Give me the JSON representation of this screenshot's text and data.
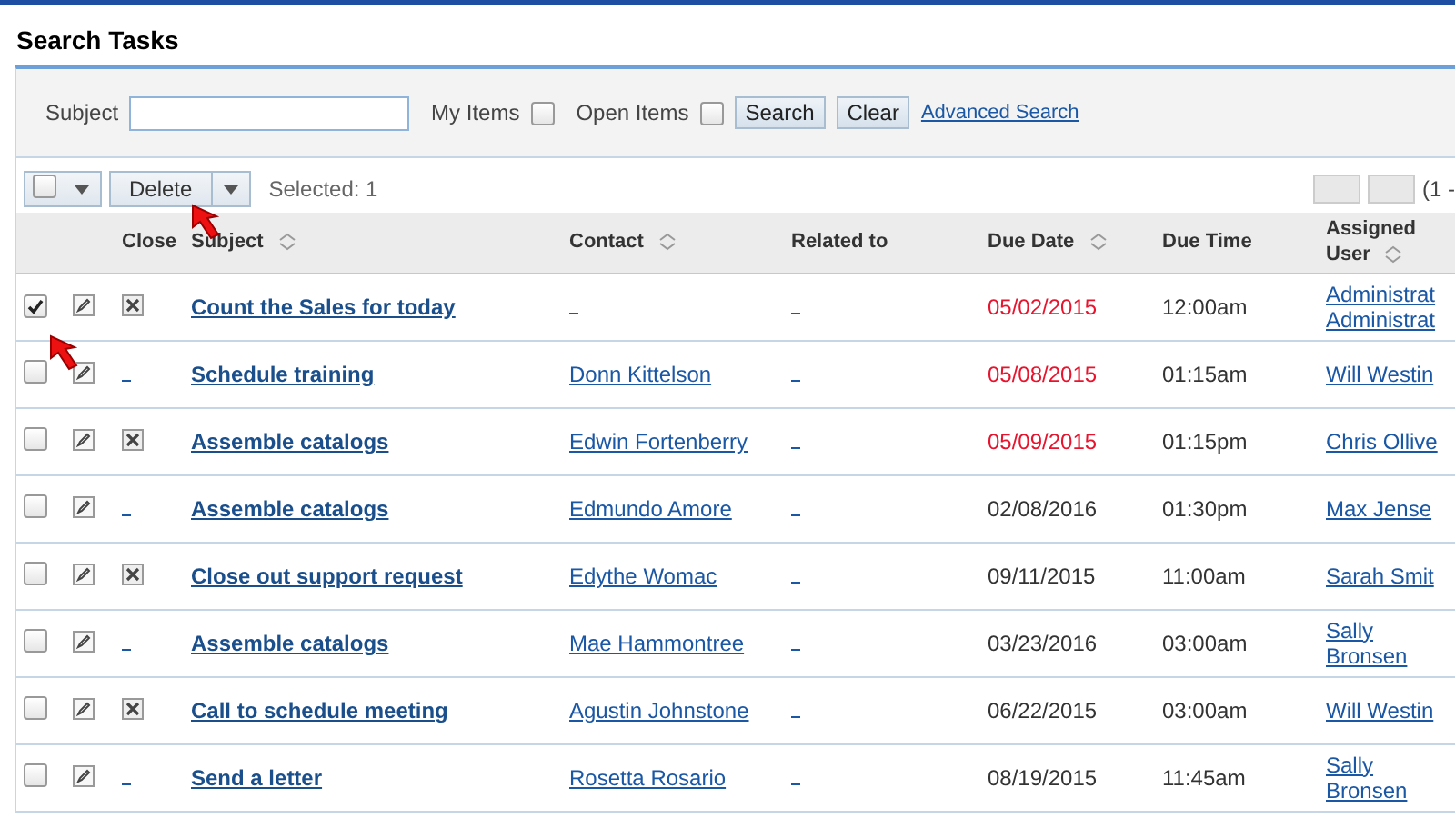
{
  "title": "Search Tasks",
  "search": {
    "subject_label": "Subject",
    "my_items_label": "My Items",
    "my_items_checked": false,
    "open_items_label": "Open Items",
    "open_items_checked": false,
    "search_button": "Search",
    "clear_button": "Clear",
    "advanced_link": "Advanced Search"
  },
  "toolbar": {
    "select_all_checked": false,
    "delete_button": "Delete",
    "selected_text": "Selected: 1",
    "paging_text": "(1 -"
  },
  "columns": [
    {
      "label": "Close",
      "sortable": false
    },
    {
      "label": "Subject",
      "sortable": true
    },
    {
      "label": "Contact",
      "sortable": true
    },
    {
      "label": "Related to",
      "sortable": false
    },
    {
      "label": "Due Date",
      "sortable": true
    },
    {
      "label": "Due Time",
      "sortable": false
    },
    {
      "label": "Assigned User",
      "sortable": true
    }
  ],
  "rows": [
    {
      "checked": true,
      "closable": true,
      "subject": "Count the Sales for today",
      "contact": "",
      "due_date": "05/02/2015",
      "overdue": true,
      "due_time": "12:00am",
      "assigned": [
        "Administrat",
        "Administrat"
      ]
    },
    {
      "checked": false,
      "closable": false,
      "subject": "Schedule training",
      "contact": "Donn Kittelson",
      "due_date": "05/08/2015",
      "overdue": true,
      "due_time": "01:15am",
      "assigned": [
        "Will Westin"
      ]
    },
    {
      "checked": false,
      "closable": true,
      "subject": "Assemble catalogs",
      "contact": "Edwin Fortenberry",
      "due_date": "05/09/2015",
      "overdue": true,
      "due_time": "01:15pm",
      "assigned": [
        "Chris Ollive"
      ]
    },
    {
      "checked": false,
      "closable": false,
      "subject": "Assemble catalogs",
      "contact": "Edmundo Amore",
      "due_date": "02/08/2016",
      "overdue": false,
      "due_time": "01:30pm",
      "assigned": [
        "Max Jense"
      ]
    },
    {
      "checked": false,
      "closable": true,
      "subject": "Close out support request",
      "contact": "Edythe Womac",
      "due_date": "09/11/2015",
      "overdue": false,
      "due_time": "11:00am",
      "assigned": [
        "Sarah Smit"
      ]
    },
    {
      "checked": false,
      "closable": false,
      "subject": "Assemble catalogs",
      "contact": "Mae Hammontree",
      "due_date": "03/23/2016",
      "overdue": false,
      "due_time": "03:00am",
      "assigned": [
        "Sally",
        "Bronsen"
      ]
    },
    {
      "checked": false,
      "closable": true,
      "subject": "Call to schedule meeting",
      "contact": "Agustin Johnstone",
      "due_date": "06/22/2015",
      "overdue": false,
      "due_time": "03:00am",
      "assigned": [
        "Will Westin"
      ]
    },
    {
      "checked": false,
      "closable": false,
      "subject": "Send a letter",
      "contact": "Rosetta Rosario",
      "due_date": "08/19/2015",
      "overdue": false,
      "due_time": "11:45am",
      "assigned": [
        "Sally",
        "Bronsen"
      ]
    }
  ]
}
